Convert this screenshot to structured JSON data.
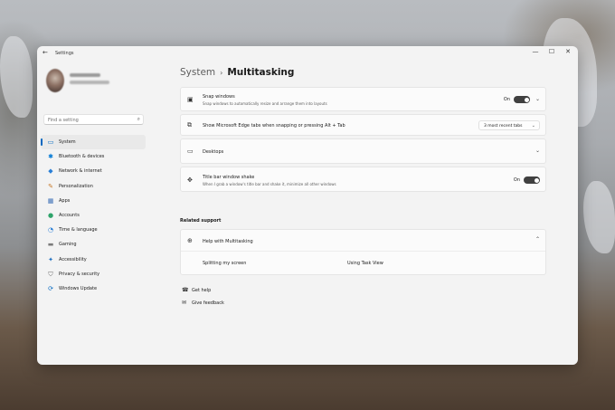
{
  "window": {
    "app_title": "Settings",
    "back_icon": "back-arrow-icon",
    "controls": {
      "minimize": "—",
      "maximize": "☐",
      "close": "✕"
    }
  },
  "sidebar": {
    "search_placeholder": "Find a setting",
    "items": [
      {
        "label": "System",
        "icon": "system-icon",
        "glyph": "▭",
        "color": "#0067c0",
        "active": true
      },
      {
        "label": "Bluetooth & devices",
        "icon": "bluetooth-icon",
        "glyph": "✱",
        "color": "#0078d4"
      },
      {
        "label": "Network & internet",
        "icon": "wifi-icon",
        "glyph": "◆",
        "color": "#2a7fd6"
      },
      {
        "label": "Personalization",
        "icon": "brush-icon",
        "glyph": "✎",
        "color": "#c77a2b"
      },
      {
        "label": "Apps",
        "icon": "apps-icon",
        "glyph": "▦",
        "color": "#3b6fb6"
      },
      {
        "label": "Accounts",
        "icon": "account-icon",
        "glyph": "●",
        "color": "#2ea36a"
      },
      {
        "label": "Time & language",
        "icon": "clock-icon",
        "glyph": "◔",
        "color": "#2a7fd6"
      },
      {
        "label": "Gaming",
        "icon": "gamepad-icon",
        "glyph": "▬",
        "color": "#7a7a7a"
      },
      {
        "label": "Accessibility",
        "icon": "accessibility-icon",
        "glyph": "✦",
        "color": "#1e6fc0"
      },
      {
        "label": "Privacy & security",
        "icon": "shield-icon",
        "glyph": "⛉",
        "color": "#6b6b6b"
      },
      {
        "label": "Windows Update",
        "icon": "update-icon",
        "glyph": "⟳",
        "color": "#0067c0"
      }
    ]
  },
  "breadcrumb": {
    "parent": "System",
    "separator": "›",
    "current": "Multitasking"
  },
  "settings": {
    "snap": {
      "title": "Snap windows",
      "desc": "Snap windows to automatically resize and arrange them into layouts",
      "toggle_label": "On",
      "icon": "snap-icon"
    },
    "edge_tabs": {
      "title": "Show Microsoft Edge tabs when snapping or pressing Alt + Tab",
      "dropdown_value": "3 most recent tabs",
      "icon": "tabs-icon"
    },
    "desktops": {
      "title": "Desktops",
      "icon": "desktops-icon"
    },
    "shake": {
      "title": "Title bar window shake",
      "desc": "When I grab a window's title bar and shake it, minimize all other windows",
      "toggle_label": "On",
      "icon": "shake-icon"
    }
  },
  "related": {
    "heading": "Related support",
    "help_title": "Help with Multitasking",
    "links": [
      "Splitting my screen",
      "Using Task View"
    ]
  },
  "footer": {
    "get_help": "Get help",
    "feedback": "Give feedback"
  }
}
